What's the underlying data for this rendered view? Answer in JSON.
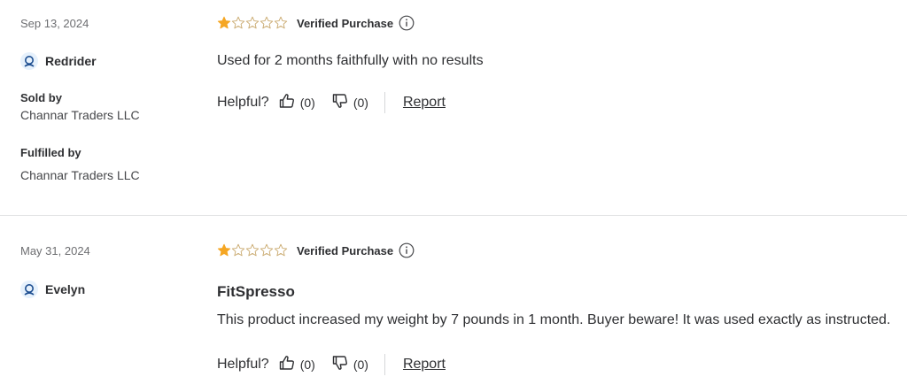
{
  "reviews": [
    {
      "date": "Sep 13, 2024",
      "user": "Redrider",
      "sold_by_label": "Sold by",
      "sold_by": "Channar Traders LLC",
      "fulfilled_by_label": "Fulfilled by",
      "fulfilled_by": "Channar Traders LLC",
      "rating": 1,
      "max_rating": 5,
      "verified": "Verified Purchase",
      "title": "",
      "text": "Used for 2 months faithfully with no results",
      "helpful_label": "Helpful?",
      "upvotes": "(0)",
      "downvotes": "(0)",
      "report": "Report"
    },
    {
      "date": "May 31, 2024",
      "user": "Evelyn",
      "rating": 1,
      "max_rating": 5,
      "verified": "Verified Purchase",
      "title": "FitSpresso",
      "text": "This product increased my weight by 7 pounds in 1 month. Buyer beware! It was used exactly as instructed.",
      "helpful_label": "Helpful?",
      "upvotes": "(0)",
      "downvotes": "(0)",
      "report": "Report"
    }
  ],
  "colors": {
    "star_filled": "#f5a623",
    "star_empty": "#c9a96e",
    "accent": "#0071dc"
  },
  "icons": {
    "user": "user-icon",
    "info": "info-icon",
    "thumbs_up": "thumbs-up-icon",
    "thumbs_down": "thumbs-down-icon",
    "star": "star-icon"
  }
}
